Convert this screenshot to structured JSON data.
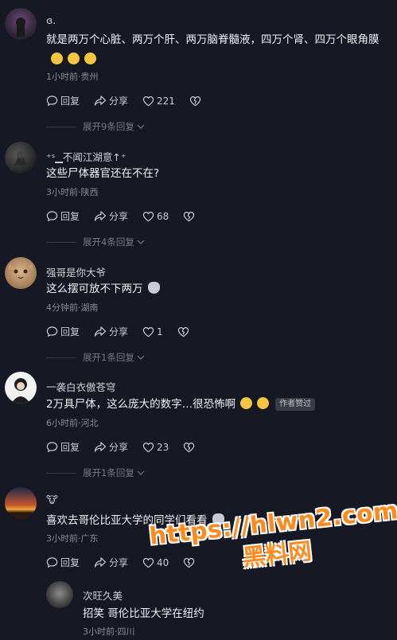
{
  "comments": [
    {
      "user": "ɞ.",
      "text": "就是两万个心脏、两万个肝、两万脑脊髓液，四万个肾、四万个眼角膜",
      "meta": "1小时前·贵州",
      "reply": "回复",
      "share": "分享",
      "likes": "221",
      "expand": "展开9条回复"
    },
    {
      "user": "⁺ˢ▁不闻江湖意↑⁺",
      "text": "这些尸体器官还在不在?",
      "meta": "3小时前·陕西",
      "reply": "回复",
      "share": "分享",
      "likes": "68",
      "expand": "展开4条回复"
    },
    {
      "user": "强哥是你大爷",
      "text": "这么摆可放不下两万",
      "meta": "4分钟前·湖南",
      "reply": "回复",
      "share": "分享",
      "likes": "1",
      "expand": "展开1条回复"
    },
    {
      "user": "一袭白衣傲苍穹",
      "text": "2万具尸体，这么庞大的数字…很恐怖啊",
      "badge": "作者赞过",
      "meta": "6小时前·河北",
      "reply": "回复",
      "share": "分享",
      "likes": "23",
      "expand": "展开1条回复"
    },
    {
      "user": "🐮",
      "text": "喜欢去哥伦比亚大学的同学们看看",
      "meta": "3小时前·广东",
      "reply": "回复",
      "share": "分享",
      "likes": "40"
    }
  ],
  "sub_reply": {
    "user": "次旺久美",
    "text": "招笑  哥伦比亚大学在纽约",
    "meta": "3小时前·四川"
  },
  "watermark": {
    "url": "https://hlwn2.com",
    "name": "黑料网"
  },
  "colors": {
    "background": "#161823",
    "watermark": "#ff8a1e"
  }
}
